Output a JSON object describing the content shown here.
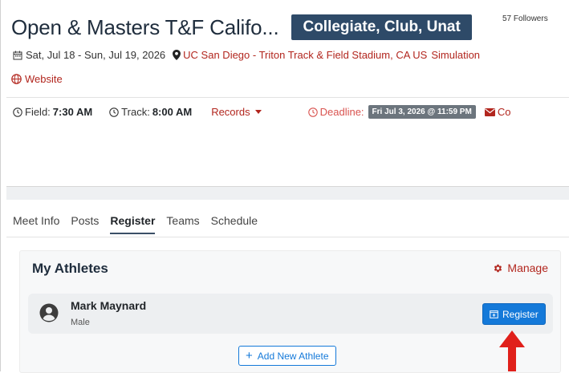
{
  "header": {
    "title": "Open & Masters T&F Califo...",
    "divisions_badge": "Collegiate, Club, Unat",
    "followers": "57 Followers",
    "dates": "Sat, Jul 18 - Sun, Jul 19, 2026",
    "location": "UC San Diego - Triton Track & Field Stadium, CA US",
    "simulation": "Simulation",
    "website": "Website"
  },
  "info": {
    "field_label": "Field:",
    "field_time": "7:30 AM",
    "track_label": "Track:",
    "track_time": "8:00 AM",
    "records": "Records",
    "deadline_label": "Deadline:",
    "deadline_value": "Fri Jul 3, 2026 @ 11:59 PM",
    "contact": "Co"
  },
  "tabs": [
    "Meet Info",
    "Posts",
    "Register",
    "Teams",
    "Schedule"
  ],
  "active_tab": "Register",
  "athletes_panel": {
    "title": "My Athletes",
    "manage": "Manage",
    "athlete": {
      "name": "Mark Maynard",
      "gender": "Male"
    },
    "register_button": "Register",
    "add_button": "Add New Athlete"
  },
  "colors": {
    "accent_red": "#b2261e",
    "badge_blue": "#2e4a68",
    "button_blue": "#1479d9",
    "arrow_red": "#e0201b"
  }
}
